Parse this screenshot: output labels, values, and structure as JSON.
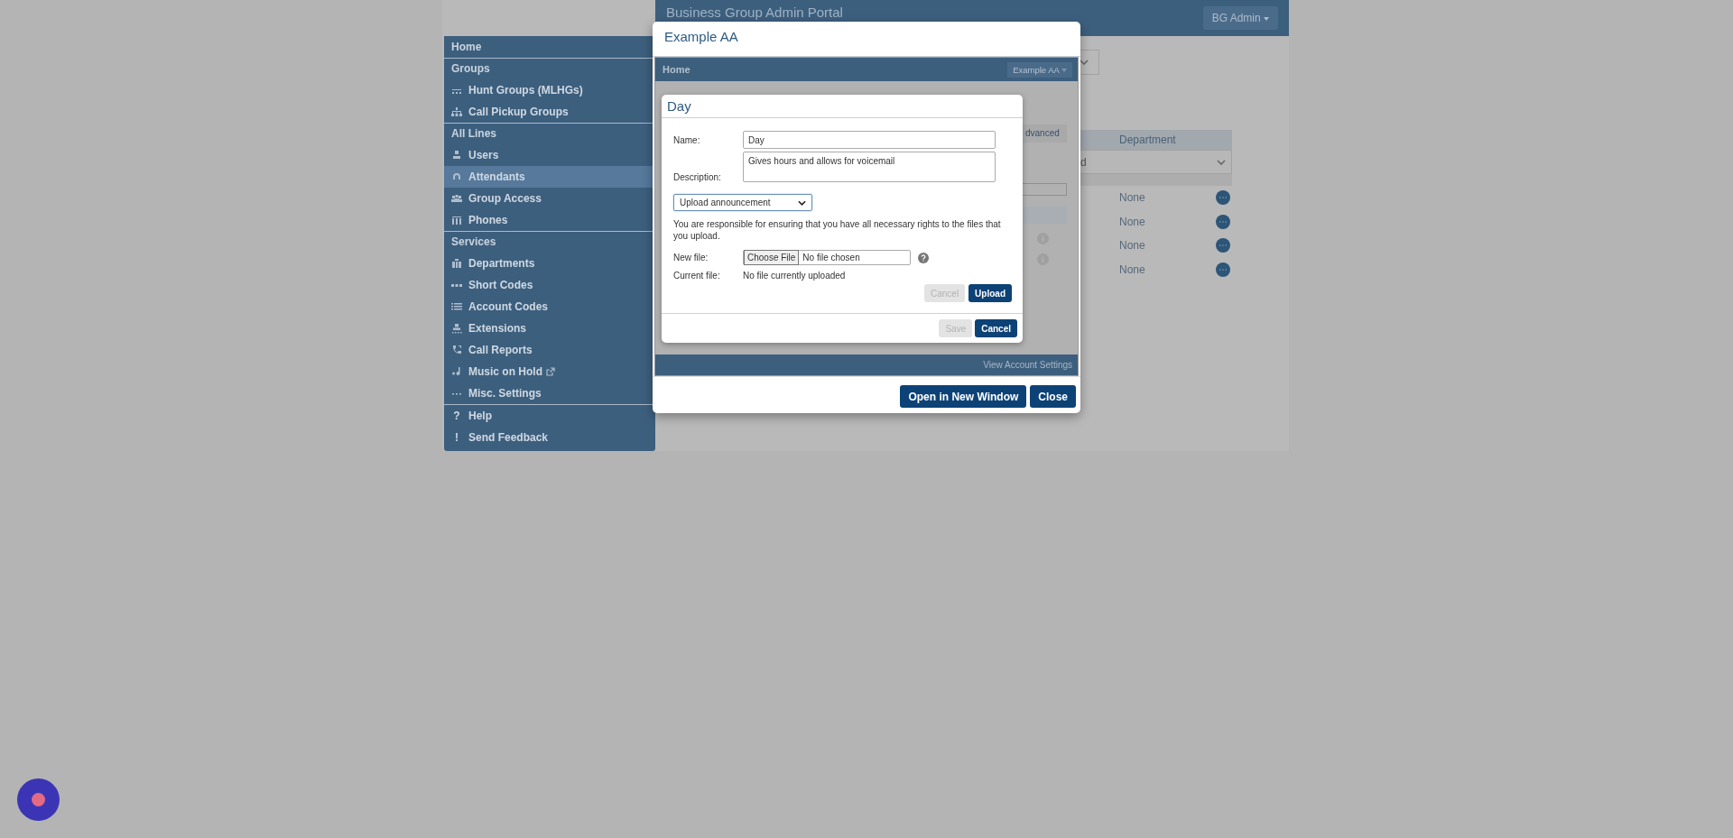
{
  "header": {
    "title": "Business Group Admin Portal",
    "user_menu": "BG Admin"
  },
  "sidebar": {
    "sections": [
      {
        "items": [
          {
            "kind": "heading",
            "label": "Home"
          }
        ]
      },
      {
        "items": [
          {
            "kind": "heading",
            "label": "Groups"
          },
          {
            "kind": "link",
            "label": "Hunt Groups (MLHGs)",
            "selected": false
          },
          {
            "kind": "link",
            "label": "Call Pickup Groups",
            "selected": false
          }
        ]
      },
      {
        "items": [
          {
            "kind": "heading",
            "label": "All Lines"
          },
          {
            "kind": "link",
            "label": "Users",
            "selected": false
          },
          {
            "kind": "link",
            "label": "Attendants",
            "selected": true
          },
          {
            "kind": "link",
            "label": "Group Access",
            "selected": false
          },
          {
            "kind": "link",
            "label": "Phones",
            "selected": false
          }
        ]
      },
      {
        "items": [
          {
            "kind": "heading",
            "label": "Services"
          },
          {
            "kind": "link",
            "label": "Departments",
            "selected": false
          },
          {
            "kind": "link",
            "label": "Short Codes",
            "selected": false
          },
          {
            "kind": "link",
            "label": "Account Codes",
            "selected": false
          },
          {
            "kind": "link",
            "label": "Extensions",
            "selected": false
          },
          {
            "kind": "link",
            "label": "Call Reports",
            "selected": false
          },
          {
            "kind": "link",
            "label": "Music on Hold",
            "selected": false,
            "external": true
          },
          {
            "kind": "link",
            "label": "Misc. Settings",
            "selected": false
          }
        ]
      },
      {
        "items": [
          {
            "kind": "link",
            "glyph": "?",
            "label": "Help",
            "selected": false
          },
          {
            "kind": "link",
            "glyph": "!",
            "label": "Send Feedback",
            "selected": false
          }
        ]
      }
    ]
  },
  "background": {
    "table_header": "Department",
    "filter_value": "d",
    "rows": [
      "None",
      "None",
      "None",
      "None"
    ]
  },
  "app_modal": {
    "title": "Example AA",
    "navbar_title": "Home",
    "account_menu": "Example AA",
    "tab": "dvanced",
    "footer_link": "View Account Settings",
    "buttons": [
      "Open in New Window",
      "Close"
    ]
  },
  "day_dialog": {
    "title": "Day",
    "name_label": "Name:",
    "name_value": "Day",
    "description_label": "Description:",
    "description_value": "Gives hours and allows for voicemail",
    "source_select": "Upload announcement",
    "notice": "You are responsible for ensuring that you have all necessary rights to the files that you upload.",
    "new_file_label": "New file:",
    "choose_button": "Choose File",
    "file_status": "No file chosen",
    "current_file_label": "Current file:",
    "current_file_value": "No file currently uploaded",
    "upload_buttons": [
      {
        "label": "Cancel",
        "disabled": true
      },
      {
        "label": "Upload",
        "disabled": false
      }
    ],
    "footer_buttons": [
      {
        "label": "Save",
        "disabled": true
      },
      {
        "label": "Cancel",
        "disabled": false
      }
    ]
  }
}
